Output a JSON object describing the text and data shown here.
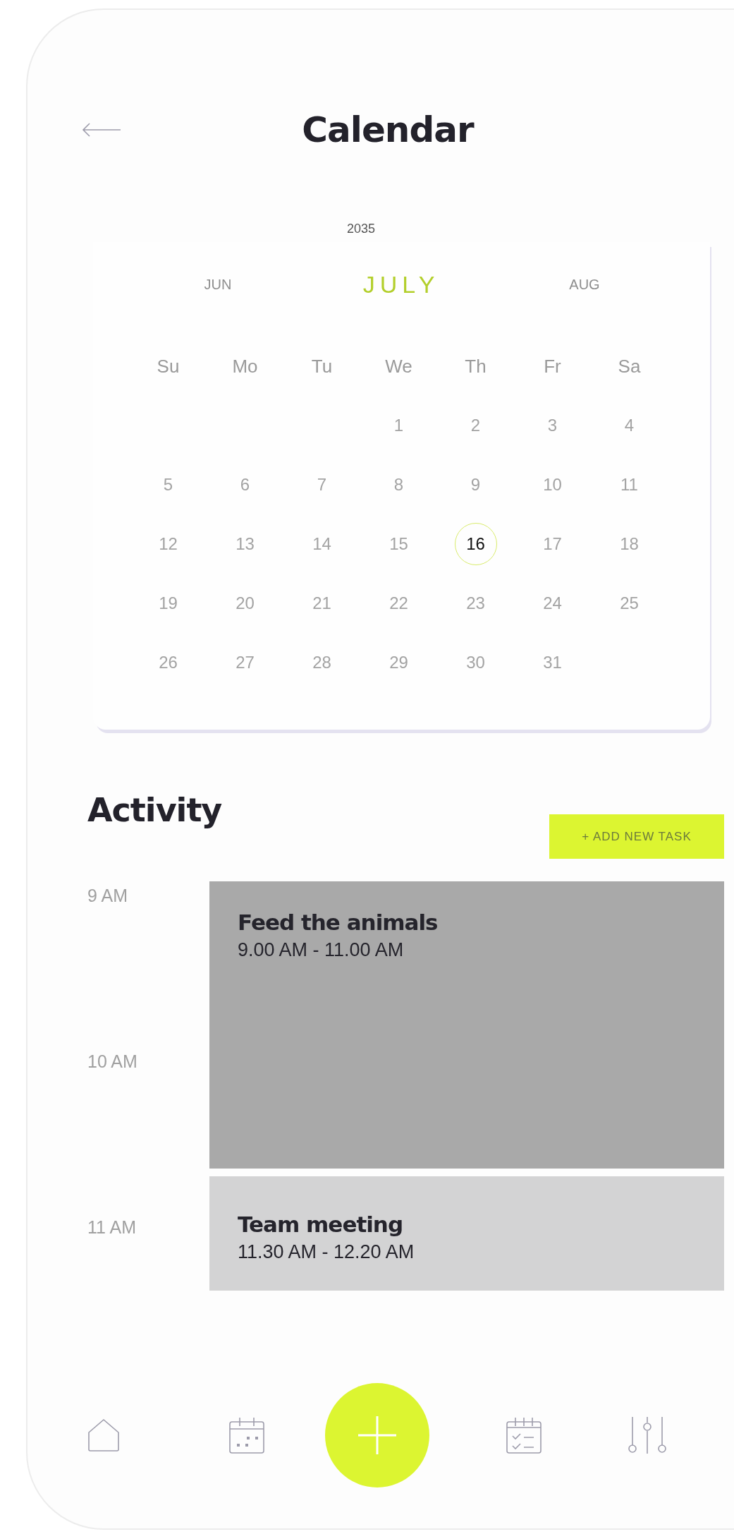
{
  "header": {
    "title": "Calendar"
  },
  "calendar": {
    "year": "2035",
    "months": [
      {
        "label": "JUN",
        "selected": false
      },
      {
        "label": "JULY",
        "selected": true
      },
      {
        "label": "AUG",
        "selected": false
      }
    ],
    "weekdays": [
      "Su",
      "Mo",
      "Tu",
      "We",
      "Th",
      "Fr",
      "Sa"
    ],
    "weeks": [
      [
        {
          "label": "1",
          "selected": false
        },
        {
          "label": "2",
          "selected": false
        },
        {
          "label": "3",
          "selected": false
        },
        {
          "label": "4",
          "selected": false
        }
      ],
      [
        {
          "label": "5",
          "selected": false
        },
        {
          "label": "6",
          "selected": false
        },
        {
          "label": "7",
          "selected": false
        },
        {
          "label": "8",
          "selected": false
        },
        {
          "label": "9",
          "selected": false
        },
        {
          "label": "10",
          "selected": false
        },
        {
          "label": "11",
          "selected": false
        }
      ],
      [
        {
          "label": "12",
          "selected": false
        },
        {
          "label": "13",
          "selected": false
        },
        {
          "label": "14",
          "selected": false
        },
        {
          "label": "15",
          "selected": false
        },
        {
          "label": "16",
          "selected": true
        },
        {
          "label": "17",
          "selected": false
        },
        {
          "label": "18",
          "selected": false
        }
      ],
      [
        {
          "label": "19",
          "selected": false
        },
        {
          "label": "20",
          "selected": false
        },
        {
          "label": "21",
          "selected": false
        },
        {
          "label": "22",
          "selected": false
        },
        {
          "label": "23",
          "selected": false
        },
        {
          "label": "24",
          "selected": false
        },
        {
          "label": "25",
          "selected": false
        }
      ],
      [
        {
          "label": "26",
          "selected": false
        },
        {
          "label": "27",
          "selected": false
        },
        {
          "label": "28",
          "selected": false
        },
        {
          "label": "29",
          "selected": false
        },
        {
          "label": "30",
          "selected": false
        },
        {
          "label": "31",
          "selected": false
        }
      ]
    ]
  },
  "activity": {
    "title": "Activity",
    "add_button": "+ ADD NEW TASK",
    "hours": [
      "9 AM",
      "10 AM",
      "11 AM"
    ],
    "events": [
      {
        "title": "Feed the animals",
        "time": "9.00 AM - 11.00 AM",
        "kind": "long",
        "color": "#a9a9a9"
      },
      {
        "title": "Team meeting",
        "time": "11.30 AM - 12.20 AM",
        "kind": "short",
        "color": "#d3d3d4"
      }
    ]
  }
}
